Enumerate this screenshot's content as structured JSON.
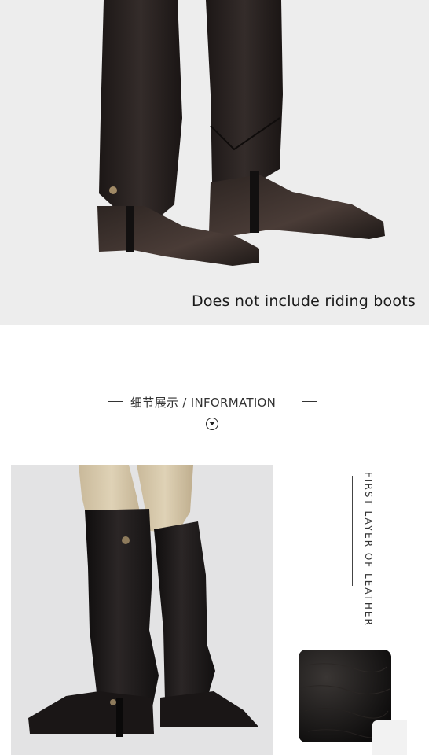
{
  "hero": {
    "caption": "Does not include riding boots",
    "image_name": "boots-with-half-chaps-closeup"
  },
  "section": {
    "title_cn": "细节展示",
    "separator": "/",
    "title_en": "INFORMATION",
    "icon": "chevron-down-circle-icon"
  },
  "detail": {
    "image_name": "rider-legs-wearing-half-chaps",
    "side_label": "FIRST LAYER OF LEATHER",
    "swatch_name": "leather-texture-swatch"
  },
  "colors": {
    "hero_bg": "#ededed",
    "leather": "#1b1716",
    "text": "#333333"
  }
}
